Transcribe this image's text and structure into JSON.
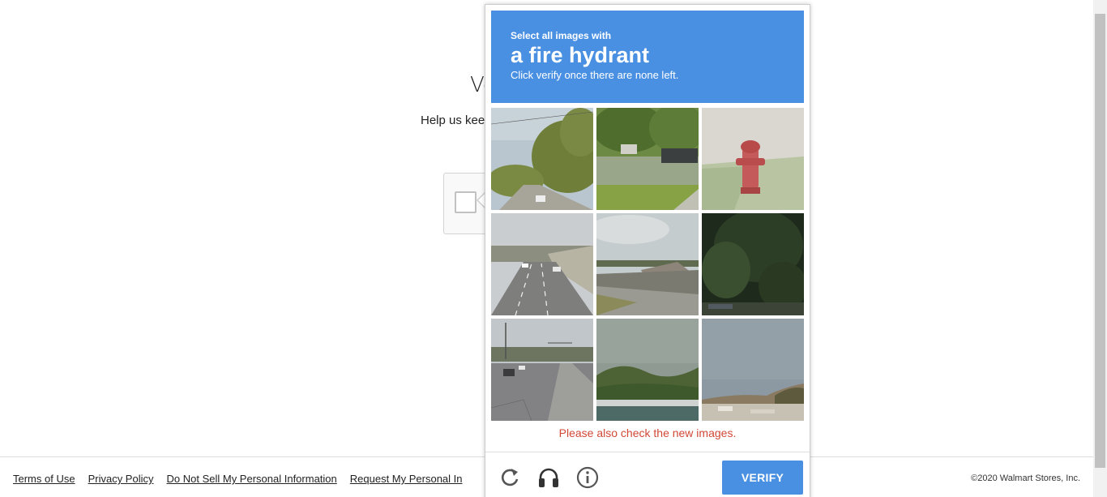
{
  "page": {
    "title_partial": "Ve",
    "subtitle_partial": "Help us kee"
  },
  "footer": {
    "links": [
      "Terms of Use",
      "Privacy Policy",
      "Do Not Sell My Personal Information",
      "Request My Personal In"
    ],
    "copyright": "©2020 Walmart Stores, Inc."
  },
  "captcha": {
    "prompt_small": "Select all images with",
    "prompt_big": "a fire hydrant",
    "prompt_note": "Click verify once there are none left.",
    "tiles": [
      "tree-lined-road",
      "park-with-cars",
      "fire-hydrant-on-sidewalk",
      "highway-overpass",
      "bridge-over-road",
      "dark-trees",
      "multi-lane-road",
      "hillside-river",
      "town-hillside"
    ],
    "error_text": "Please also check the new images.",
    "verify_label": "VERIFY",
    "icons": [
      "reload-icon",
      "audio-icon",
      "info-icon"
    ],
    "accent_color": "#4a90e2",
    "error_color": "#d14836"
  }
}
